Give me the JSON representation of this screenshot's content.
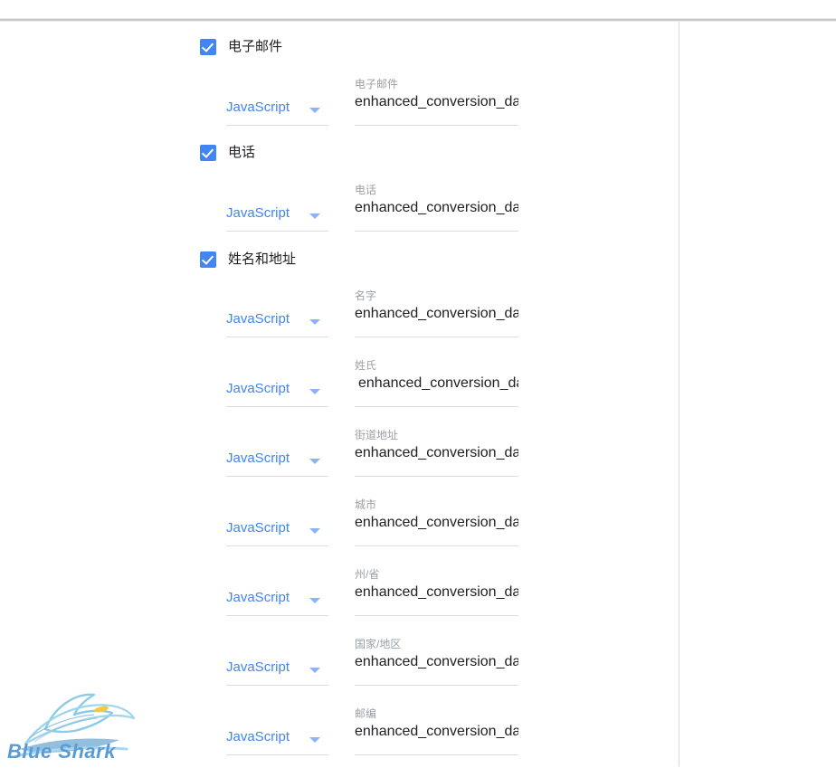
{
  "window": {
    "background_color": "#ffffff",
    "divider_color": "#d8d8d8",
    "accent_color": "#4285f4",
    "label_color": "#9aa0a6",
    "value_color": "#202124"
  },
  "sections": [
    {
      "id": "email",
      "checkbox_label": "电子邮件",
      "checked": true,
      "fields": [
        {
          "source_label": "JavaScript",
          "field_label": "电子邮件",
          "value": "enhanced_conversion_data",
          "shifted": false
        }
      ]
    },
    {
      "id": "phone",
      "checkbox_label": "电话",
      "checked": true,
      "fields": [
        {
          "source_label": "JavaScript",
          "field_label": "电话",
          "value": "enhanced_conversion_data",
          "shifted": false
        }
      ]
    },
    {
      "id": "name-and-address",
      "checkbox_label": "姓名和地址",
      "checked": true,
      "fields": [
        {
          "source_label": "JavaScript",
          "field_label": "名字",
          "value": "enhanced_conversion_data",
          "shifted": false
        },
        {
          "source_label": "JavaScript",
          "field_label": "姓氏",
          "value": "enhanced_conversion_data",
          "shifted": true
        },
        {
          "source_label": "JavaScript",
          "field_label": "街道地址",
          "value": "enhanced_conversion_data",
          "shifted": false
        },
        {
          "source_label": "JavaScript",
          "field_label": "城市",
          "value": "enhanced_conversion_data",
          "shifted": false
        },
        {
          "source_label": "JavaScript",
          "field_label": "州/省",
          "value": "enhanced_conversion_data",
          "shifted": false
        },
        {
          "source_label": "JavaScript",
          "field_label": "国家/地区",
          "value": "enhanced_conversion_data",
          "shifted": false
        },
        {
          "source_label": "JavaScript",
          "field_label": "邮编",
          "value": "enhanced_conversion_data",
          "shifted": false
        }
      ]
    }
  ],
  "watermark": {
    "text": "Blue Shark",
    "color": "#5b9bd5",
    "icon": "shark-wave-logo"
  }
}
